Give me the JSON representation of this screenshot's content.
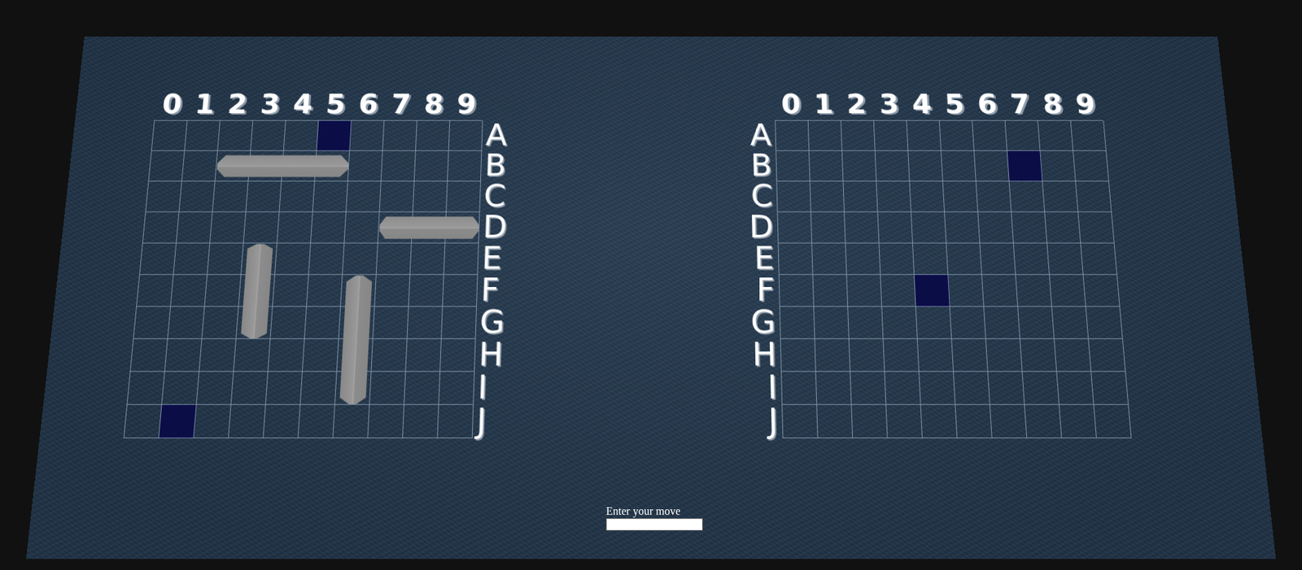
{
  "boards": [
    {
      "kind": "own",
      "columns": [
        "0",
        "1",
        "2",
        "3",
        "4",
        "5",
        "6",
        "7",
        "8",
        "9"
      ],
      "rows": [
        "A",
        "B",
        "C",
        "D",
        "E",
        "F",
        "G",
        "H",
        "I",
        "J"
      ],
      "ships": [
        {
          "row": 1,
          "col": 2,
          "length": 4,
          "vertical": false
        },
        {
          "row": 3,
          "col": 7,
          "length": 3,
          "vertical": false
        },
        {
          "row": 4,
          "col": 3,
          "length": 3,
          "vertical": true
        },
        {
          "row": 5,
          "col": 6,
          "length": 4,
          "vertical": true
        }
      ],
      "marks": [
        {
          "row": 0,
          "col": 5
        },
        {
          "row": 9,
          "col": 1
        }
      ]
    },
    {
      "kind": "target",
      "columns": [
        "0",
        "1",
        "2",
        "3",
        "4",
        "5",
        "6",
        "7",
        "8",
        "9"
      ],
      "rows": [
        "A",
        "B",
        "C",
        "D",
        "E",
        "F",
        "G",
        "H",
        "I",
        "J"
      ],
      "ships": [],
      "marks": [
        {
          "row": 1,
          "col": 7
        },
        {
          "row": 5,
          "col": 4
        }
      ]
    }
  ],
  "move_input": {
    "label": "Enter your move",
    "value": ""
  }
}
